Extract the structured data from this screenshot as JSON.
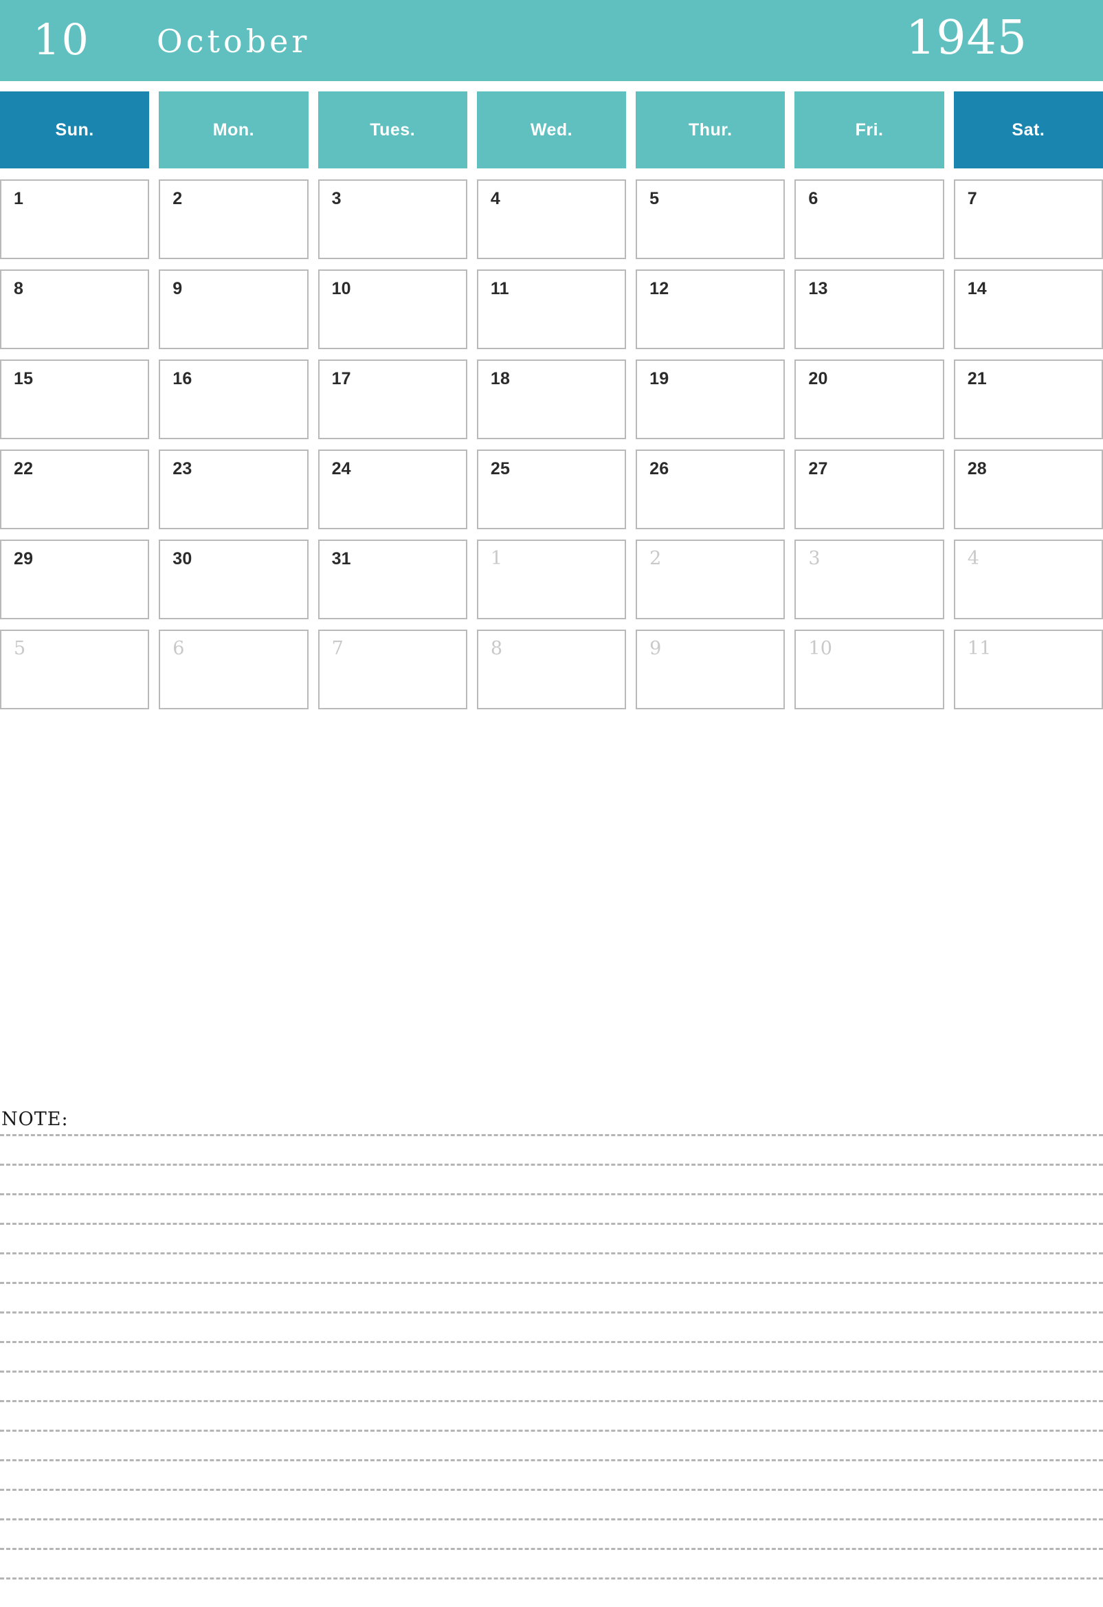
{
  "banner": {
    "month_number": "10",
    "month_name": "October",
    "year": "1945",
    "bg_color": "#5fc0bf",
    "text_color": "#ffffff"
  },
  "colors": {
    "teal": "#5fc0bf",
    "dark_blue": "#1a85ae",
    "cell_border": "#b9b9b9",
    "date_text": "#2b2b2b",
    "muted_date_text": "#c9c9c9",
    "note_line": "#b5b5b5"
  },
  "weekdays": [
    {
      "label": "Sun.",
      "weekend": true
    },
    {
      "label": "Mon.",
      "weekend": false
    },
    {
      "label": "Tues.",
      "weekend": false
    },
    {
      "label": "Wed.",
      "weekend": false
    },
    {
      "label": "Thur.",
      "weekend": false
    },
    {
      "label": "Fri.",
      "weekend": false
    },
    {
      "label": "Sat.",
      "weekend": true
    }
  ],
  "weeks": [
    [
      {
        "day": "1",
        "muted": false
      },
      {
        "day": "2",
        "muted": false
      },
      {
        "day": "3",
        "muted": false
      },
      {
        "day": "4",
        "muted": false
      },
      {
        "day": "5",
        "muted": false
      },
      {
        "day": "6",
        "muted": false
      },
      {
        "day": "7",
        "muted": false
      }
    ],
    [
      {
        "day": "8",
        "muted": false
      },
      {
        "day": "9",
        "muted": false
      },
      {
        "day": "10",
        "muted": false
      },
      {
        "day": "11",
        "muted": false
      },
      {
        "day": "12",
        "muted": false
      },
      {
        "day": "13",
        "muted": false
      },
      {
        "day": "14",
        "muted": false
      }
    ],
    [
      {
        "day": "15",
        "muted": false
      },
      {
        "day": "16",
        "muted": false
      },
      {
        "day": "17",
        "muted": false
      },
      {
        "day": "18",
        "muted": false
      },
      {
        "day": "19",
        "muted": false
      },
      {
        "day": "20",
        "muted": false
      },
      {
        "day": "21",
        "muted": false
      }
    ],
    [
      {
        "day": "22",
        "muted": false
      },
      {
        "day": "23",
        "muted": false
      },
      {
        "day": "24",
        "muted": false
      },
      {
        "day": "25",
        "muted": false
      },
      {
        "day": "26",
        "muted": false
      },
      {
        "day": "27",
        "muted": false
      },
      {
        "day": "28",
        "muted": false
      }
    ],
    [
      {
        "day": "29",
        "muted": false
      },
      {
        "day": "30",
        "muted": false
      },
      {
        "day": "31",
        "muted": false
      },
      {
        "day": "1",
        "muted": true
      },
      {
        "day": "2",
        "muted": true
      },
      {
        "day": "3",
        "muted": true
      },
      {
        "day": "4",
        "muted": true
      }
    ],
    [
      {
        "day": "5",
        "muted": true
      },
      {
        "day": "6",
        "muted": true
      },
      {
        "day": "7",
        "muted": true
      },
      {
        "day": "8",
        "muted": true
      },
      {
        "day": "9",
        "muted": true
      },
      {
        "day": "10",
        "muted": true
      },
      {
        "day": "11",
        "muted": true
      }
    ]
  ],
  "note": {
    "label": "NOTE:",
    "line_count": 16
  }
}
